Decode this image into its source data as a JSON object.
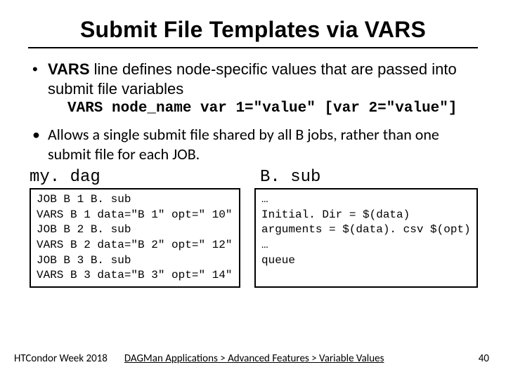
{
  "title": "Submit File Templates via VARS",
  "bullet1_pre": "VARS",
  "bullet1_rest": " line defines node-specific values that are passed into submit file variables",
  "syntax": "VARS node_name var 1=\"value\" [var 2=\"value\"]",
  "bullet2": "Allows a single submit file shared by all B jobs, rather than one submit file for each JOB.",
  "label_left": "my. dag",
  "label_right": "B. sub",
  "code_left": "JOB B 1 B. sub\nVARS B 1 data=\"B 1\" opt=\" 10\"\nJOB B 2 B. sub\nVARS B 2 data=\"B 2\" opt=\" 12\"\nJOB B 3 B. sub\nVARS B 3 data=\"B 3\" opt=\" 14\"",
  "code_right": "…\nInitial. Dir = $(data)\narguments = $(data). csv $(opt)\n…\nqueue",
  "footer": {
    "event": "HTCondor Week 2018",
    "breadcrumb": "DAGMan Applications > Advanced Features > Variable Values",
    "page": "40"
  }
}
